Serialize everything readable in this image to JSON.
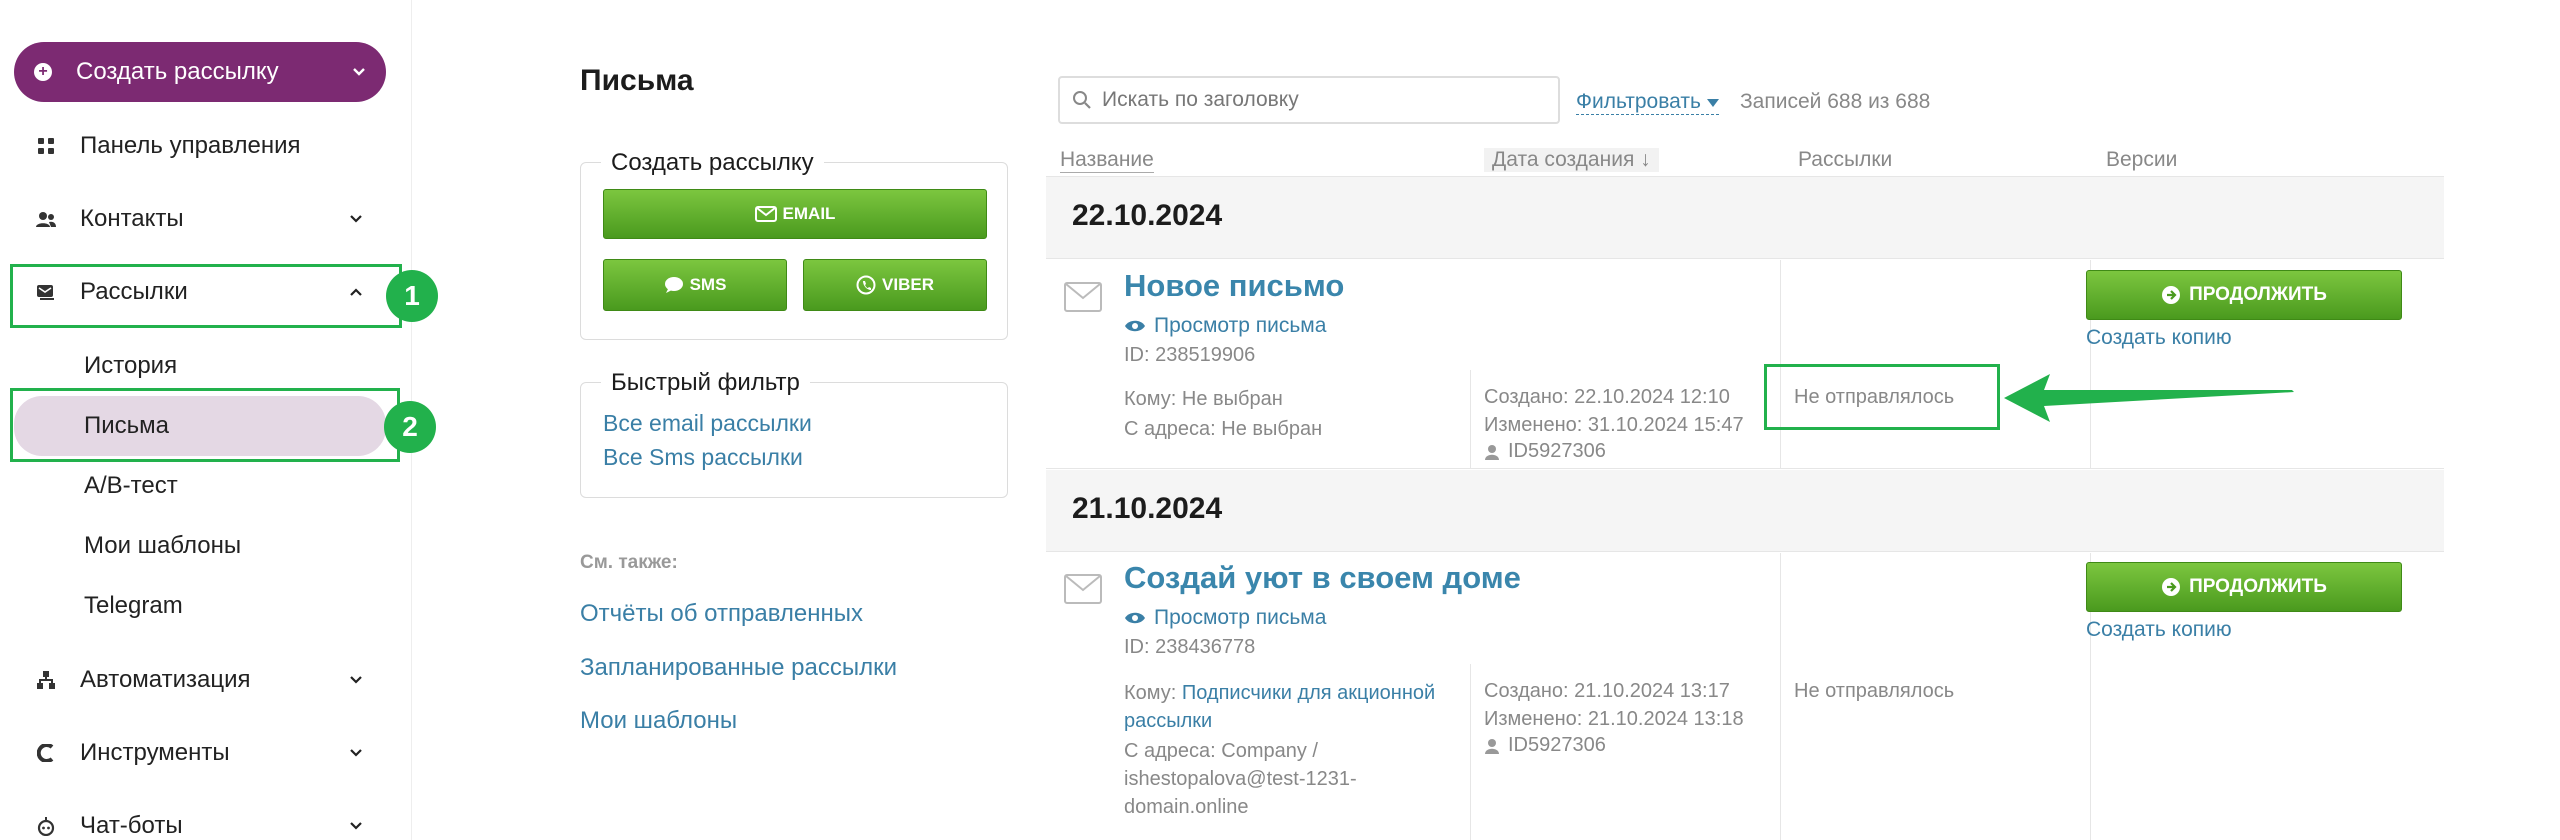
{
  "sidebar": {
    "create_button": "Создать рассылку",
    "items": [
      {
        "label": "Панель управления",
        "icon": "dashboard-icon"
      },
      {
        "label": "Контакты",
        "icon": "contacts-icon"
      },
      {
        "label": "Рассылки",
        "icon": "mailings-icon"
      },
      {
        "label": "Автоматизация",
        "icon": "automation-icon"
      },
      {
        "label": "Инструменты",
        "icon": "tools-icon"
      },
      {
        "label": "Чат-боты",
        "icon": "chatbot-icon"
      }
    ],
    "sub_items": [
      "История",
      "Письма",
      "A/B-тест",
      "Мои шаблоны",
      "Telegram"
    ],
    "badges": [
      "1",
      "2"
    ]
  },
  "page": {
    "title": "Письма",
    "create_box": {
      "legend": "Создать рассылку",
      "email": "EMAIL",
      "sms": "SMS",
      "viber": "VIBER"
    },
    "quick_filter": {
      "legend": "Быстрый фильтр",
      "links": [
        "Все email рассылки",
        "Все Sms рассылки"
      ]
    },
    "see_also": {
      "title": "См. также:",
      "links": [
        "Отчёты об отправленных",
        "Запланированные рассылки",
        "Мои шаблоны"
      ]
    }
  },
  "toolbar": {
    "search_placeholder": "Искать по заголовку",
    "filter_label": "Фильтровать",
    "count": "Записей 688 из 688"
  },
  "table": {
    "headers": [
      "Название",
      "Дата создания ↓",
      "Рассылки",
      "Версии"
    ],
    "groups": [
      {
        "date": "22.10.2024",
        "title": "Новое письмо",
        "view": "Просмотр письма",
        "id": "ID: 238519906",
        "to_label": "Кому:",
        "to_value": "Не выбран",
        "from_label": "С адреса:",
        "from_value": "Не выбран",
        "created": "Создано: 22.10.2024 12:10",
        "changed": "Изменено: 31.10.2024 15:47",
        "user": "ID5927306",
        "status": "Не отправлялось",
        "continue": "ПРОДОЛЖИТЬ",
        "copy": "Создать копию"
      },
      {
        "date": "21.10.2024",
        "title": "Создай уют в своем доме",
        "view": "Просмотр письма",
        "id": "ID: 238436778",
        "to_label": "Кому:",
        "to_value_1": "Подписчики для акционной",
        "to_value_2": "рассылки",
        "from_1": "С адреса: Company /",
        "from_2": "ishestopalova@test-1231-",
        "from_3": "domain.online",
        "created": "Создано: 21.10.2024 13:17",
        "changed": "Изменено: 21.10.2024 13:18",
        "user": "ID5927306",
        "status": "Не отправлялось",
        "continue": "ПРОДОЛЖИТЬ",
        "copy": "Создать копию"
      }
    ]
  },
  "colors": {
    "accent": "#7c2a72",
    "highlight": "#22b14c",
    "link": "#3a7fa6",
    "button_green": "#5aab27"
  }
}
